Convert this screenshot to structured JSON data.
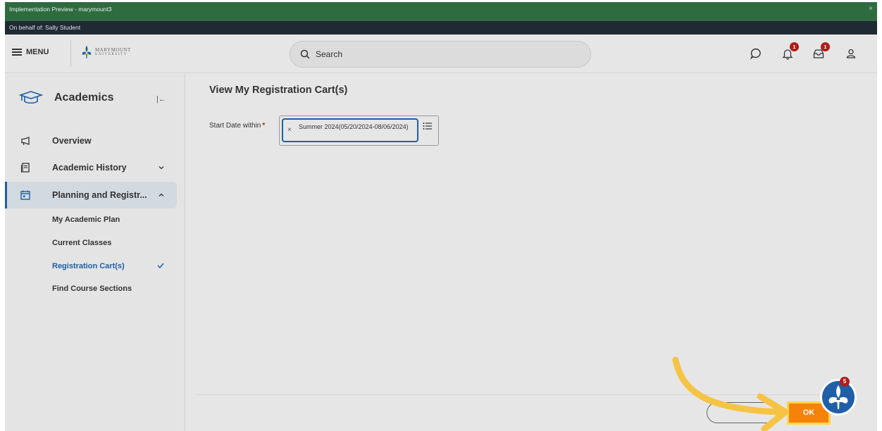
{
  "window": {
    "preview_title": "Implementation Preview - marymount3",
    "behalf_text": "On behalf of: Sally Student",
    "close_glyph": "×"
  },
  "header": {
    "menu_label": "MENU",
    "logo_top": "MARYMOUNT",
    "logo_bottom": "UNIVERSITY",
    "search_placeholder": "Search",
    "notifications_count": "1",
    "inbox_count": "1",
    "icons": [
      "chat-icon",
      "bell-icon",
      "inbox-icon",
      "profile-icon"
    ]
  },
  "sidebar": {
    "title": "Academics",
    "collapse_glyph": "|←",
    "items": [
      {
        "label": "Overview",
        "icon": "megaphone-icon"
      },
      {
        "label": "Academic History",
        "icon": "document-icon",
        "expanded": false
      },
      {
        "label": "Planning and Registr...",
        "icon": "calendar-icon",
        "expanded": true
      }
    ],
    "sub_items": [
      {
        "label": "My Academic Plan"
      },
      {
        "label": "Current Classes"
      },
      {
        "label": "Registration Cart(s)",
        "current": true
      },
      {
        "label": "Find Course Sections"
      }
    ]
  },
  "main": {
    "title": "View My Registration Cart(s)",
    "field_label": "Start Date within",
    "required_mark": "*",
    "selected_value": "Summer 2024(05/20/2024-08/06/2024)",
    "remove_glyph": "×"
  },
  "footer": {
    "ok_label": "OK",
    "cancel_label": ""
  },
  "assistant": {
    "badge_count": "5"
  },
  "colors": {
    "preview_bar": "#2e6b3f",
    "behalf_bar": "#1f2a33",
    "accent_blue": "#1f5fa8",
    "ok_orange": "#f5820a",
    "highlight_yellow": "#ffd54a",
    "badge_red": "#b11b1b"
  }
}
